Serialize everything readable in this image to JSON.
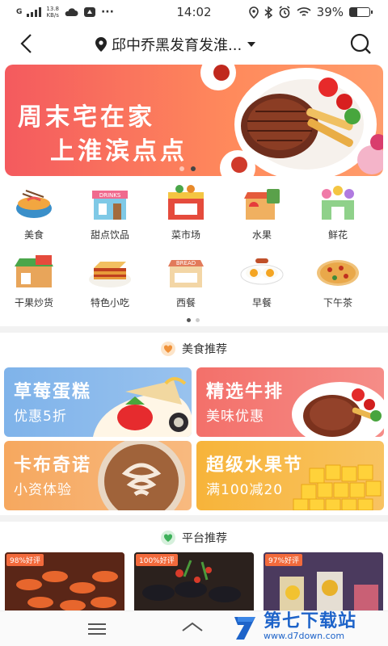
{
  "status_bar": {
    "network": "13.8\nKB/s",
    "time": "14:02",
    "battery": "39%",
    "battery_level": 0.39
  },
  "header": {
    "location": "邱中乔黑发育发淮...",
    "icons": [
      "back-icon",
      "location-pin-icon",
      "dropdown-icon",
      "search-icon"
    ]
  },
  "banner": {
    "line1": "周末宅在家",
    "line2": "上淮滨点点",
    "slide": 2,
    "slides": 2
  },
  "categories": [
    {
      "label": "美食",
      "icon": "food-bowl-icon"
    },
    {
      "label": "甜点饮品",
      "icon": "drinks-shop-icon"
    },
    {
      "label": "菜市场",
      "icon": "supermarket-icon"
    },
    {
      "label": "水果",
      "icon": "fruit-shop-icon"
    },
    {
      "label": "鲜花",
      "icon": "flower-shop-icon"
    },
    {
      "label": "干果炒货",
      "icon": "dry-goods-shop-icon"
    },
    {
      "label": "特色小吃",
      "icon": "lasagna-icon"
    },
    {
      "label": "西餐",
      "icon": "bread-shop-icon"
    },
    {
      "label": "早餐",
      "icon": "fried-eggs-icon"
    },
    {
      "label": "下午茶",
      "icon": "pizza-icon"
    }
  ],
  "section_food": {
    "title": "美食推荐",
    "icon": "heart-icon"
  },
  "promos": [
    {
      "title": "草莓蛋糕",
      "subtitle": "优惠5折",
      "color": "#7fb3ea"
    },
    {
      "title": "精选牛排",
      "subtitle": "美味优惠",
      "color": "#f3706a"
    },
    {
      "title": "卡布奇诺",
      "subtitle": "小资体验",
      "color": "#f6a85f"
    },
    {
      "title": "超级水果节",
      "subtitle": "满100减20",
      "color": "#f7b43a"
    }
  ],
  "section_platform": {
    "title": "平台推荐",
    "icon": "heart-icon"
  },
  "cards": [
    {
      "badge": "98%好评"
    },
    {
      "badge": "100%好评"
    },
    {
      "badge": "97%好评"
    }
  ],
  "watermark": {
    "brand": "第七下载站",
    "url": "www.d7down.com"
  },
  "colors": {
    "accent": "#f45a5e",
    "heart_orange": "#f0923a",
    "heart_green": "#3db15a"
  }
}
